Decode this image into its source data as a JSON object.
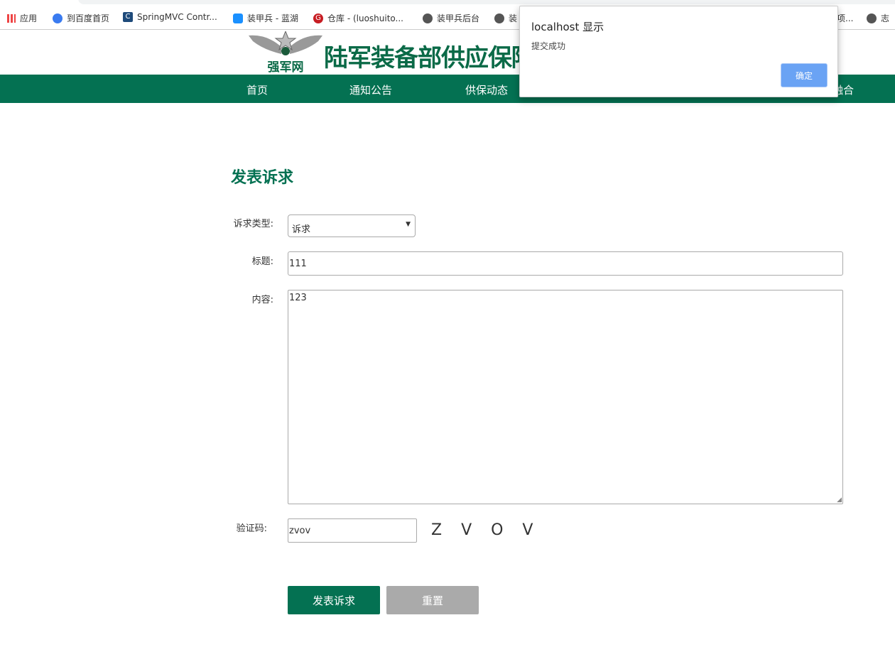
{
  "bookmarks": [
    {
      "label": "应用",
      "icon": "apps-grid-icon"
    },
    {
      "label": "到百度首页",
      "icon": "baidu-paw-icon"
    },
    {
      "label": "SpringMVC Contr...",
      "icon": "site-c-icon"
    },
    {
      "label": "装甲兵 - 蓝湖",
      "icon": "lanhu-icon"
    },
    {
      "label": "仓库 - (luoshuito...",
      "icon": "gitee-g-icon"
    },
    {
      "label": "装甲兵后台",
      "icon": "globe-icon"
    },
    {
      "label": "装",
      "icon": "globe-icon"
    },
    {
      "label": "项...",
      "icon": "globe-icon"
    },
    {
      "label": "志",
      "icon": "globe-icon"
    }
  ],
  "site": {
    "logo_text": "强军网",
    "title": "陆军装备部供应保障局"
  },
  "nav": [
    "首页",
    "通知公告",
    "供保动态",
    "融合"
  ],
  "form": {
    "heading": "发表诉求",
    "type_label": "诉求类型:",
    "type_value": "诉求",
    "title_label": "标题:",
    "title_value": "111",
    "content_label": "内容:",
    "content_value": "123",
    "captcha_label": "验证码:",
    "captcha_value": "zvov",
    "captcha_image_text": "Z V O V",
    "submit": "发表诉求",
    "reset": "重置"
  },
  "dialog": {
    "title": "localhost 显示",
    "message": "提交成功",
    "ok": "确定"
  },
  "colors": {
    "brand": "#047152",
    "dialog_button": "#6aa3f4"
  }
}
